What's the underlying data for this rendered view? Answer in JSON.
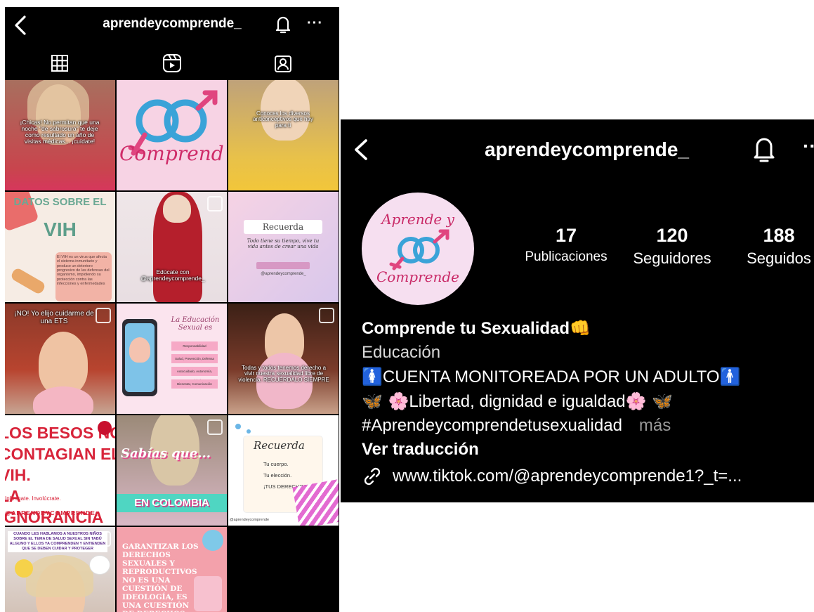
{
  "left": {
    "handle": "aprendeycomprende_",
    "more": "···",
    "posts": [
      {
        "caption": "¡Chicas! No permitan que una noche \"de sabrosura\" te deje como resultado un año de visitas médicas... ¡cuídate!"
      },
      {
        "caption": "Comprend"
      },
      {
        "caption": "Conoces los diversos anticonceptivos que hay para ti"
      },
      {
        "title": "DATOS SOBRE EL",
        "big": "VIH",
        "caption": "El VIH es un virus que afecta el sistema inmunitario y produce un deterioro progresivo de las defensas del organismo, impidiendo su protección contra las infecciones y enfermedades"
      },
      {
        "caption": "Edúcate con @aprendeycomprende_"
      },
      {
        "title": "Recuerda",
        "caption": "Todo tiene su tiempo, vive tu vida antes de crear una vida",
        "handle": "@aprendeycomprende_"
      },
      {
        "caption": "¡NO! Yo elijo cuidarme de una ETS"
      },
      {
        "title": "La Educación Sexual es",
        "items": [
          "Responsabilidad",
          "Salud, Prevención, Defensa",
          "Autocuidado, Autonomía, Igualdad",
          "Bienestar, Comunicación"
        ]
      },
      {
        "caption": "Todas y todos tenemos derecho a vivir nuestra sexualidad libre de violencia. RECUÉRDALO SIEMPRE"
      },
      {
        "lines": [
          "LOS BESOS NO",
          "CONTAGIAN EL VIH.",
          "LA IGNORANCIA SÍ."
        ],
        "sub": "Infórmate. Involúcrate.",
        "handle": "@APRENDEYCOMPRENDE_"
      },
      {
        "title": "Sabías que...",
        "banner": "EN COLOMBIA"
      },
      {
        "title": "Recuerda",
        "lines": [
          "Tu cuerpo.",
          "Tu elección.",
          "¡TUS DERECHOS!"
        ],
        "handle": "@aprendeycomprende"
      },
      {
        "caption": "CUANDO LES HABLAMOS A NUESTROS NIÑOS SOBRE EL TEMA DE SALUD SEXUAL SIN TABÚ ALGUNO Y ELLOS YA COMPRENDEN Y ENTIENDEN QUE SE DEBEN CUIDAR Y PROTEGER"
      },
      {
        "caption": "GARANTIZAR LOS DERECHOS SEXUALES Y REPRODUCTIVOS NO ES UNA CUESTIÓN DE IDEOLOGÍA, ES UNA CUESTIÓN DE DERECHOS HUMANOS."
      }
    ]
  },
  "right": {
    "handle": "aprendeycomprende_",
    "more": "··",
    "avatar_text": {
      "top": "Aprende y",
      "bottom": "Comprende"
    },
    "stats": [
      {
        "num": "17",
        "label": "Publicaciones"
      },
      {
        "num": "120",
        "label": "Seguidores"
      },
      {
        "num": "188",
        "label": "Seguidos"
      }
    ],
    "bio": {
      "name": "Comprende tu Sexualidad",
      "name_emoji": "👊",
      "category": "Educación",
      "line1": "CUENTA MONITOREADA POR UN ADULTO",
      "line1_pre": "🚺",
      "line1_post": "🚹",
      "line2": "Libertad, dignidad e igualdad",
      "line2_pre": "🦋 🌸",
      "line2_post": "🌸 🦋",
      "hashtag": "#Aprendeycomprendetusexualidad",
      "more": "más",
      "translate": "Ver traducción"
    },
    "link": "www.tiktok.com/@aprendeycomprende1?_t=..."
  },
  "colors": {
    "bg": "#000000",
    "accent_pink": "#f2a6c8",
    "accent_blue": "#3aa3d8"
  }
}
